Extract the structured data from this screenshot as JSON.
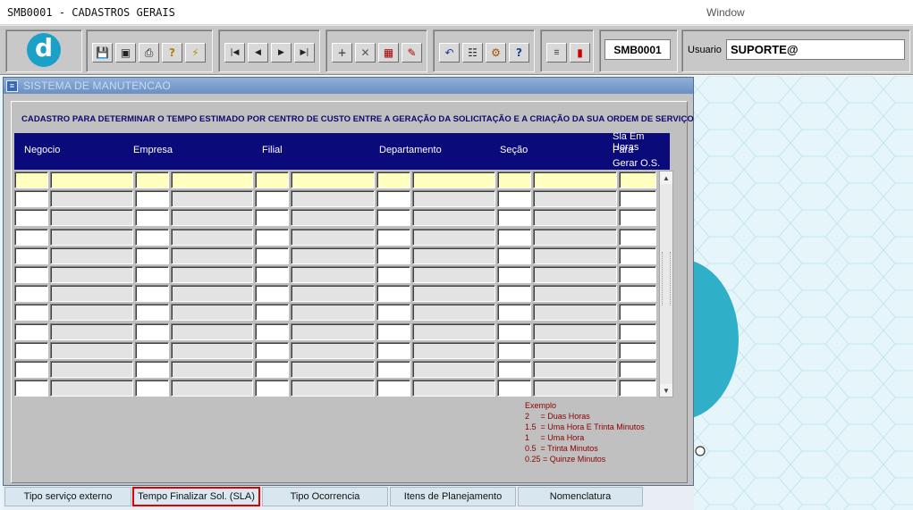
{
  "window": {
    "title": "SMB0001 - CADASTROS GERAIS",
    "menu_label": "Window"
  },
  "toolbar": {
    "logo_letter": "d",
    "form_code": "SMB0001",
    "usuario_label": "Usuario",
    "usuario_value": "SUPORTE@",
    "buttons_group1": [
      "save-icon",
      "screen-icon",
      "print-icon",
      "query-icon",
      "execute-query-icon"
    ],
    "buttons_group2": [
      "first-record-icon",
      "previous-record-icon",
      "next-record-icon",
      "last-record-icon"
    ],
    "buttons_group3": [
      "insert-record-icon",
      "delete-record-icon",
      "clear-form-icon",
      "edit-icon"
    ],
    "buttons_group4": [
      "undo-icon",
      "clipboard-icon",
      "settings-icon",
      "help-icon"
    ],
    "buttons_group5": [
      "menu-icon",
      "exit-icon"
    ]
  },
  "subwindow": {
    "caption": "SISTEMA DE MANUTENCAO"
  },
  "form": {
    "description": "CADASTRO PARA DETERMINAR O TEMPO ESTIMADO POR CENTRO DE CUSTO ENTRE A GERAÇÃO DA SOLICITAÇÃO E A CRIAÇÃO DA SUA ORDEM DE SERVIÇO",
    "columns": {
      "negocio": "Negocio",
      "empresa": "Empresa",
      "filial": "Filial",
      "departamento": "Departamento",
      "secao": "Seção",
      "sla_line1": "Sla Em Horas",
      "sla_line2": "Para",
      "sla_line3": "Gerar O.S."
    },
    "row_count": 12,
    "example": {
      "title": "Exemplo",
      "lines": [
        "2     = Duas Horas",
        "1.5  = Uma Hora E Trinta Minutos",
        "1     = Uma Hora",
        "0.5  = Trinta Minutos",
        "0.25 = Quinze Minutos"
      ]
    }
  },
  "tabs": [
    {
      "label": "Tipo serviço externo",
      "active": false
    },
    {
      "label": "Tempo Finalizar Sol. (SLA)",
      "active": true
    },
    {
      "label": "Tipo Ocorrencia",
      "active": false
    },
    {
      "label": "Itens de Planejamento",
      "active": false
    },
    {
      "label": "Nomenclatura",
      "active": false
    }
  ],
  "colors": {
    "grid_header": "#0a0a7a",
    "current_row": "#ffffc0",
    "example_text": "#8b0000",
    "active_tab_border": "#e00000"
  }
}
